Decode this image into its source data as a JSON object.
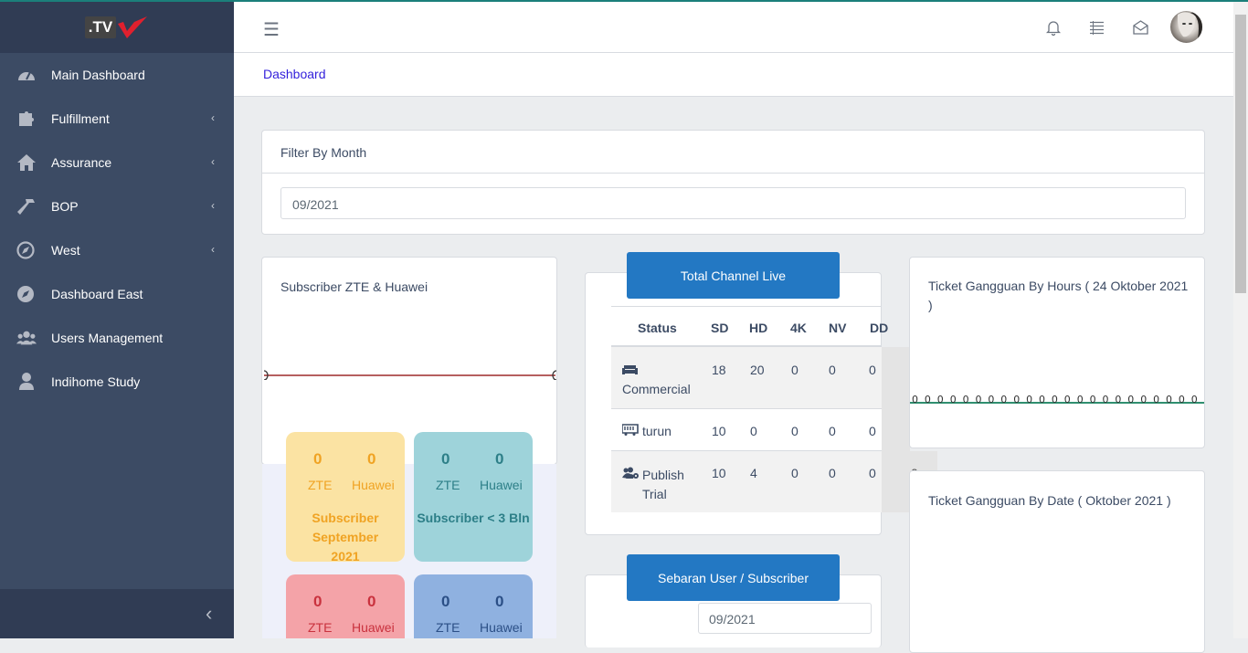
{
  "sidebar": {
    "logo_text": ".TV",
    "items": [
      {
        "label": "Main Dashboard",
        "icon": "speedometer-icon",
        "chevron": ""
      },
      {
        "label": "Fulfillment",
        "icon": "puzzle-icon",
        "chevron": "‹"
      },
      {
        "label": "Assurance",
        "icon": "home-icon",
        "chevron": "‹"
      },
      {
        "label": "BOP",
        "icon": "hammer-icon",
        "chevron": "‹"
      },
      {
        "label": "West",
        "icon": "compass-icon",
        "chevron": "‹"
      },
      {
        "label": "Dashboard East",
        "icon": "compass-circle-icon",
        "chevron": ""
      },
      {
        "label": "Users Management",
        "icon": "users-icon",
        "chevron": ""
      },
      {
        "label": "Indihome Study",
        "icon": "user-icon",
        "chevron": ""
      }
    ],
    "minimize_glyph": "‹"
  },
  "header": {
    "menu_glyph": "☰"
  },
  "breadcrumb": {
    "item": "Dashboard"
  },
  "filter": {
    "title": "Filter By Month",
    "value": "09/2021"
  },
  "subscriber_card": {
    "title": "Subscriber ZTE & Huawei"
  },
  "stat_boxes": [
    {
      "zte_value": "0",
      "huawei_value": "0",
      "zte_label": "ZTE",
      "huawei_label": "Huawei",
      "caption": "Subscriber September 2021",
      "bg": "#fbe3a3",
      "fg": "#f0a323"
    },
    {
      "zte_value": "0",
      "huawei_value": "0",
      "zte_label": "ZTE",
      "huawei_label": "Huawei",
      "caption": "Subscriber < 3 Bln",
      "bg": "#9ed3da",
      "fg": "#2d7f88"
    },
    {
      "zte_value": "0",
      "huawei_value": "0",
      "zte_label": "ZTE",
      "huawei_label": "Huawei",
      "bg": "#f4a3a8",
      "fg": "#c9323e"
    },
    {
      "zte_value": "0",
      "huawei_value": "0",
      "zte_label": "ZTE",
      "huawei_label": "Huawei",
      "bg": "#8fb1e0",
      "fg": "#2b4f86"
    }
  ],
  "channel": {
    "button_label": "Total Channel Live",
    "headers": [
      "Status",
      "SD",
      "HD",
      "4K",
      "NV",
      "DD"
    ],
    "rows": [
      {
        "icon": "sofa-icon",
        "status": "Commercial",
        "values": [
          "18",
          "20",
          "0",
          "0",
          "0"
        ]
      },
      {
        "icon": "bus-icon",
        "status": "turun",
        "values": [
          "10",
          "0",
          "0",
          "0",
          "0"
        ]
      },
      {
        "icon": "users-gear-icon",
        "status": "Publish Trial",
        "values": [
          "10",
          "4",
          "0",
          "0",
          "0"
        ]
      }
    ],
    "overflow_text": "0"
  },
  "sebaran": {
    "button_label": "Sebaran User / Subscriber",
    "value": "09/2021"
  },
  "ticket_hours": {
    "title": "Ticket Gangguan By Hours ( 24 Oktober 2021 )",
    "points_label": "0"
  },
  "ticket_date": {
    "title": "Ticket Gangguan By Date ( Oktober 2021 )"
  },
  "colors": {
    "sidebar": "#3c4b64",
    "sidebar_dark": "#303c54",
    "accent_blue": "#2378c3",
    "breadcrumb_link": "#321fdb",
    "red_line": "#9e2a2a",
    "green_line": "#2f8f6f"
  }
}
